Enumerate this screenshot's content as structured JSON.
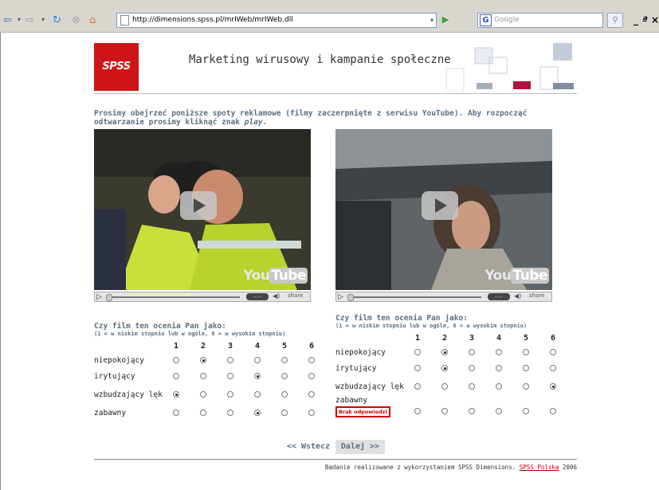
{
  "browser": {
    "url": "http://dimensions.spss.pl/mrIWeb/mrIWeb.dll",
    "search_placeholder": "Google",
    "search_logo": "G"
  },
  "header": {
    "logo_text": "SPSS",
    "title": "Marketing wirusowy i kampanie społeczne"
  },
  "intro": {
    "text_before": "Prosimy obejrzeć poniższe spoty reklamowe (filmy zaczerpnięte z serwisu YouTube). Aby rozpocząć odtwarzanie prosimy kliknąć znak ",
    "emph": "play",
    "text_after": "."
  },
  "player": {
    "logo_you": "You",
    "logo_tube": "Tube",
    "time": "--:--",
    "share": "share"
  },
  "question": {
    "title": "Czy film ten ocenia Pan jako:",
    "subtitle": "(1 = w niskim stopniu lub w ogóle, 6 = w wysokim stopniu)",
    "scale": [
      "1",
      "2",
      "3",
      "4",
      "5",
      "6"
    ]
  },
  "grid_left": {
    "rows": [
      {
        "label": "niepokojący",
        "selected": 2,
        "error": false
      },
      {
        "label": "irytujący",
        "selected": 4,
        "error": false
      },
      {
        "label": "wzbudzający lęk",
        "selected": 1,
        "error": false
      },
      {
        "label": "zabawny",
        "selected": 4,
        "error": false
      }
    ]
  },
  "grid_right": {
    "rows": [
      {
        "label": "niepokojący",
        "selected": 2,
        "error": false
      },
      {
        "label": "irytujący",
        "selected": 2,
        "error": false
      },
      {
        "label": "wzbudzający lęk",
        "selected": 6,
        "error": false
      },
      {
        "label": "zabawny",
        "selected": 0,
        "error": true
      }
    ],
    "error_text": "Brak odpowiedzi"
  },
  "nav": {
    "prev": "<< Wstecz",
    "next": "Dalej >>"
  },
  "footer": {
    "text": "Badanie realizowane z wykorzystaniem SPSS Dimensions. ",
    "link": "SPSS Polska",
    "year": " 2006"
  },
  "colors": {
    "brand_red": "#cf1418",
    "text_blue_gray": "#5c6e82",
    "error_red": "#d40000"
  }
}
